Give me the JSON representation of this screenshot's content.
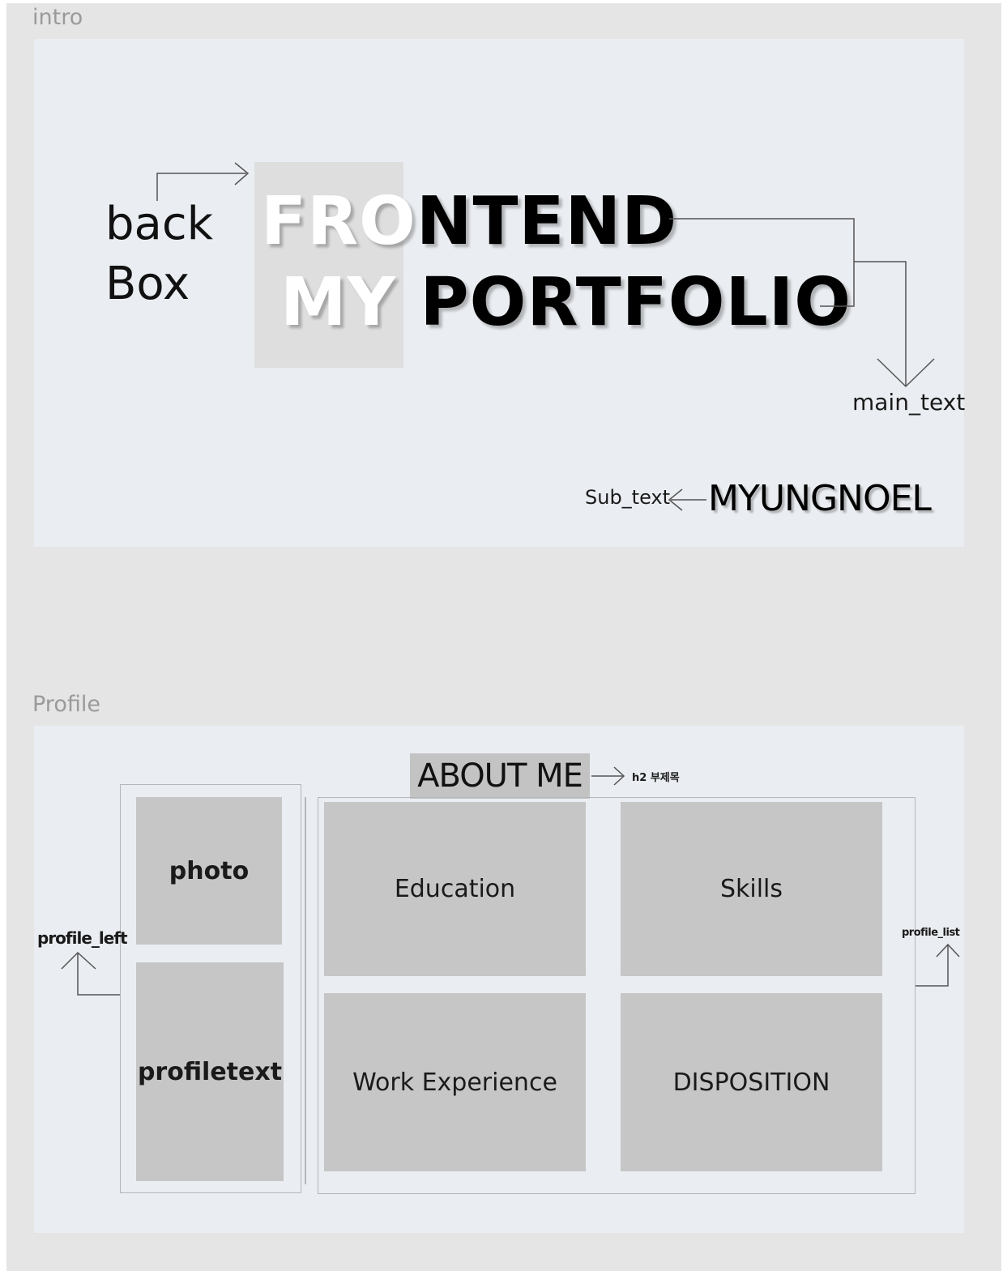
{
  "intro": {
    "frame_label": "intro",
    "back_box_line1": "back",
    "back_box_line2": "Box",
    "main_text": {
      "line1_white": "FRO",
      "line1_black": "NTEND",
      "line2_white": "MY",
      "line2_black": "PORTFOLIO"
    },
    "main_text_label": "main_text",
    "sub_text_label": "Sub_text",
    "sub_text_value": "MYUNGNOEL"
  },
  "profile": {
    "frame_label": "Profile",
    "heading": "ABOUT ME",
    "heading_note": "h2 부제목",
    "left_label": "profile_left",
    "list_label": "profile_list",
    "photo_label": "photo",
    "profiletext_label": "profiletext",
    "cards": [
      "Education",
      "Skills",
      "Work Experience",
      "DISPOSITION"
    ]
  }
}
